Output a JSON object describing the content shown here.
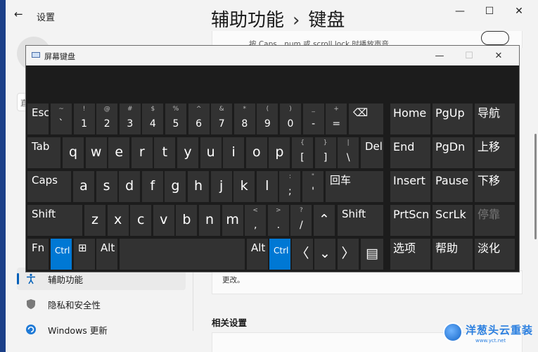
{
  "settings": {
    "app_title": "设置",
    "breadcrumb_parent": "辅助功能",
    "breadcrumb_sep": "›",
    "breadcrumb_current": "键盘",
    "window_controls": {
      "minimize": "—",
      "maximize": "☐",
      "close": "✕"
    },
    "top_card_text": "按 Caps、num 或 scroll lock 时播放声音",
    "lower_card_text": "更改。",
    "related_section": "相关设置",
    "search_stub": "直",
    "sidebar": [
      {
        "label": "辅助功能",
        "icon": "accessibility-icon",
        "active": true
      },
      {
        "label": "隐私和安全性",
        "icon": "shield-icon",
        "active": false
      },
      {
        "label": "Windows 更新",
        "icon": "windows-update-icon",
        "active": false
      }
    ]
  },
  "osk": {
    "title": "屏幕键盘",
    "controls": {
      "minimize": "—",
      "maximize": "☐",
      "close": "✕"
    },
    "keys": [
      {
        "k": "esc",
        "t": "Esc"
      },
      {
        "k": "backtick",
        "sh": "~",
        "mn": "`"
      },
      {
        "k": "1",
        "sh": "!",
        "mn": "1"
      },
      {
        "k": "2",
        "sh": "@",
        "mn": "2"
      },
      {
        "k": "3",
        "sh": "#",
        "mn": "3"
      },
      {
        "k": "4",
        "sh": "$",
        "mn": "4"
      },
      {
        "k": "5",
        "sh": "%",
        "mn": "5"
      },
      {
        "k": "6",
        "sh": "^",
        "mn": "6"
      },
      {
        "k": "7",
        "sh": "&",
        "mn": "7"
      },
      {
        "k": "8",
        "sh": "*",
        "mn": "8"
      },
      {
        "k": "9",
        "sh": "(",
        "mn": "9"
      },
      {
        "k": "0",
        "sh": ")",
        "mn": "0"
      },
      {
        "k": "minus",
        "sh": "_",
        "mn": "-"
      },
      {
        "k": "equals",
        "sh": "+",
        "mn": "="
      },
      {
        "k": "backspace",
        "t": "⌫"
      },
      {
        "k": "tab",
        "t": "Tab"
      },
      {
        "k": "q",
        "m": "q"
      },
      {
        "k": "w",
        "m": "w"
      },
      {
        "k": "e",
        "m": "e"
      },
      {
        "k": "r",
        "m": "r"
      },
      {
        "k": "t",
        "m": "t"
      },
      {
        "k": "y",
        "m": "y"
      },
      {
        "k": "u",
        "m": "u"
      },
      {
        "k": "i",
        "m": "i"
      },
      {
        "k": "o",
        "m": "o"
      },
      {
        "k": "p",
        "m": "p"
      },
      {
        "k": "lbracket",
        "sh": "{",
        "mn": "["
      },
      {
        "k": "rbracket",
        "sh": "}",
        "mn": "]"
      },
      {
        "k": "backslash",
        "sh": "|",
        "mn": "\\"
      },
      {
        "k": "del",
        "t": "Del"
      },
      {
        "k": "caps",
        "t": "Caps"
      },
      {
        "k": "a",
        "m": "a"
      },
      {
        "k": "s",
        "m": "s"
      },
      {
        "k": "d",
        "m": "d"
      },
      {
        "k": "f",
        "m": "f"
      },
      {
        "k": "g",
        "m": "g"
      },
      {
        "k": "h",
        "m": "h"
      },
      {
        "k": "j",
        "m": "j"
      },
      {
        "k": "kk",
        "m": "k"
      },
      {
        "k": "l",
        "m": "l"
      },
      {
        "k": "semicolon",
        "sh": ":",
        "mn": ";"
      },
      {
        "k": "quote",
        "sh": "\"",
        "mn": "'"
      },
      {
        "k": "enter",
        "t": "回车"
      },
      {
        "k": "lshift",
        "t": "Shift"
      },
      {
        "k": "z",
        "m": "z"
      },
      {
        "k": "x",
        "m": "x"
      },
      {
        "k": "c",
        "m": "c"
      },
      {
        "k": "v",
        "m": "v"
      },
      {
        "k": "b",
        "m": "b"
      },
      {
        "k": "n",
        "m": "n"
      },
      {
        "k": "mm",
        "m": "m"
      },
      {
        "k": "comma",
        "sh": "<",
        "mn": ","
      },
      {
        "k": "period",
        "sh": ">",
        "mn": "."
      },
      {
        "k": "slash",
        "sh": "?",
        "mn": "/"
      },
      {
        "k": "up",
        "m": "⌃"
      },
      {
        "k": "rshift",
        "t": "Shift"
      },
      {
        "k": "fn",
        "t": "Fn"
      },
      {
        "k": "lctrl",
        "t": "Ctrl",
        "blue": true
      },
      {
        "k": "win",
        "t": "⊞"
      },
      {
        "k": "lalt",
        "t": "Alt"
      },
      {
        "k": "space",
        "t": ""
      },
      {
        "k": "ralt",
        "t": "Alt"
      },
      {
        "k": "rctrl",
        "t": "Ctrl",
        "blue": true
      },
      {
        "k": "left",
        "m": "〈"
      },
      {
        "k": "down",
        "m": "⌄"
      },
      {
        "k": "right",
        "m": "〉"
      },
      {
        "k": "menu",
        "m": "▤"
      },
      {
        "k": "home",
        "nav": "Home"
      },
      {
        "k": "pgup",
        "nav": "PgUp"
      },
      {
        "k": "navigate",
        "nav": "导航"
      },
      {
        "k": "end",
        "nav": "End"
      },
      {
        "k": "pgdn",
        "nav": "PgDn"
      },
      {
        "k": "moveup",
        "nav": "上移"
      },
      {
        "k": "insert",
        "nav": "Insert"
      },
      {
        "k": "pause",
        "nav": "Pause"
      },
      {
        "k": "movedown",
        "nav": "下移"
      },
      {
        "k": "prtscn",
        "nav": "PrtScn"
      },
      {
        "k": "scrlk",
        "nav": "ScrLk"
      },
      {
        "k": "dock",
        "nav": "停靠",
        "dis": true
      },
      {
        "k": "options",
        "nav": "选项"
      },
      {
        "k": "help",
        "nav": "帮助"
      },
      {
        "k": "fade",
        "nav": "淡化"
      }
    ]
  },
  "watermark": {
    "text": "洋葱头云重装",
    "url": "www.yct.net"
  }
}
